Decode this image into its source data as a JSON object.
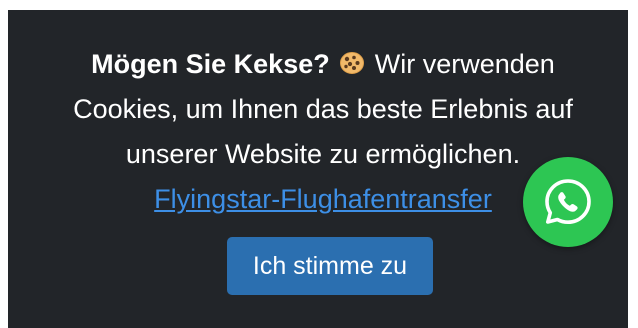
{
  "cookie_banner": {
    "heading": "Mögen Sie Kekse?",
    "icon": "cookie-icon",
    "message": "Wir verwenden Cookies, um Ihnen das beste Erlebnis auf unserer Website zu ermöglichen.",
    "link_text": "Flyingstar-Flughafentransfer",
    "accept_label": "Ich stimme zu"
  },
  "whatsapp": {
    "icon": "whatsapp-icon"
  },
  "colors": {
    "banner_bg": "#222529",
    "text": "#ffffff",
    "link": "#3d8fe6",
    "button_bg": "#2b6fb0",
    "whatsapp_green": "#2dc653"
  }
}
